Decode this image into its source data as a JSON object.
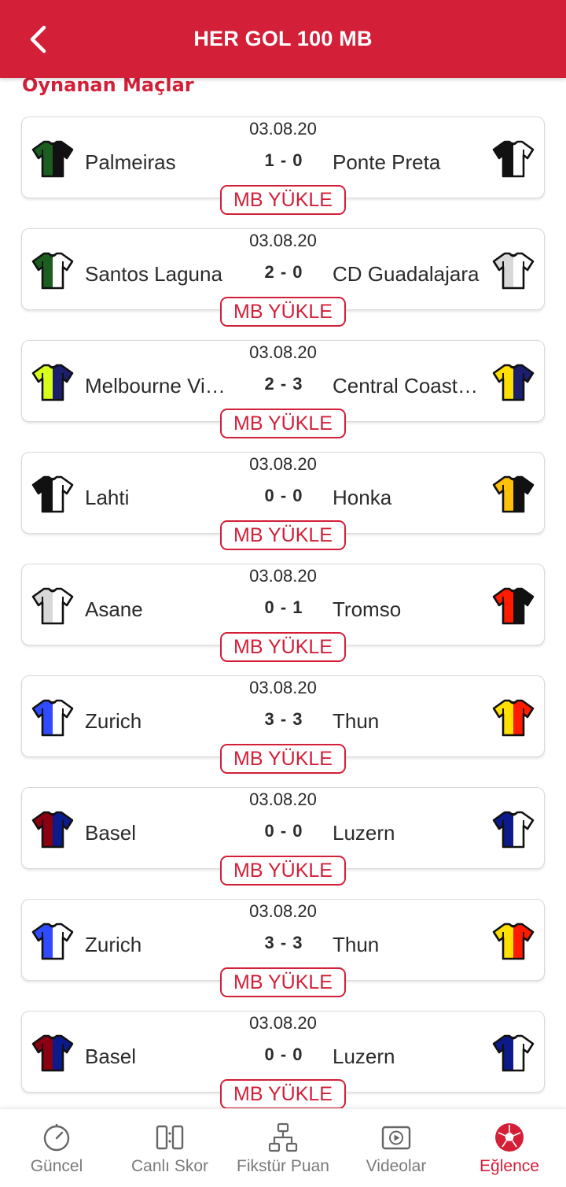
{
  "header": {
    "title": "HER GOL 100 MB",
    "back_icon": "chevron-left-icon"
  },
  "section_title": "Oynanan Maçlar",
  "colors": {
    "brand": "#d31f37",
    "text": "#2b2b2b",
    "inactive": "#7a7a7a"
  },
  "matches": [
    {
      "date": "03.08.20",
      "home": "Palmeiras",
      "score": "1 - 0",
      "away": "Ponte Preta",
      "button": "MB YÜKLE",
      "home_kit": [
        "#1b5e20",
        "#111111"
      ],
      "away_kit": [
        "#111111",
        "#ffffff"
      ]
    },
    {
      "date": "03.08.20",
      "home": "Santos Laguna",
      "score": "2 - 0",
      "away": "CD Guadalajara",
      "button": "MB YÜKLE",
      "home_kit": [
        "#1b5e20",
        "#ffffff"
      ],
      "away_kit": [
        "#d8d8d8",
        "#ffffff"
      ]
    },
    {
      "date": "03.08.20",
      "home": "Melbourne Vi…",
      "score": "2 - 3",
      "away": "Central Coast…",
      "button": "MB YÜKLE",
      "home_kit": [
        "#d7ff1a",
        "#1b1f6e"
      ],
      "away_kit": [
        "#ffe000",
        "#1b1f6e"
      ]
    },
    {
      "date": "03.08.20",
      "home": "Lahti",
      "score": "0 - 0",
      "away": "Honka",
      "button": "MB YÜKLE",
      "home_kit": [
        "#111111",
        "#ffffff"
      ],
      "away_kit": [
        "#ffc107",
        "#111111"
      ]
    },
    {
      "date": "03.08.20",
      "home": "Asane",
      "score": "0 - 1",
      "away": "Tromso",
      "button": "MB YÜKLE",
      "home_kit": [
        "#d8d8d8",
        "#ffffff"
      ],
      "away_kit": [
        "#ff1a00",
        "#111111"
      ]
    },
    {
      "date": "03.08.20",
      "home": "Zurich",
      "score": "3 - 3",
      "away": "Thun",
      "button": "MB YÜKLE",
      "home_kit": [
        "#2f4bff",
        "#ffffff"
      ],
      "away_kit": [
        "#ffe000",
        "#ff1a00"
      ]
    },
    {
      "date": "03.08.20",
      "home": "Basel",
      "score": "0 - 0",
      "away": "Luzern",
      "button": "MB YÜKLE",
      "home_kit": [
        "#8b0010",
        "#0d1a8c"
      ],
      "away_kit": [
        "#0d1a8c",
        "#ffffff"
      ]
    },
    {
      "date": "03.08.20",
      "home": "Zurich",
      "score": "3 - 3",
      "away": "Thun",
      "button": "MB YÜKLE",
      "home_kit": [
        "#2f4bff",
        "#ffffff"
      ],
      "away_kit": [
        "#ffe000",
        "#ff1a00"
      ]
    },
    {
      "date": "03.08.20",
      "home": "Basel",
      "score": "0 - 0",
      "away": "Luzern",
      "button": "MB YÜKLE",
      "home_kit": [
        "#8b0010",
        "#0d1a8c"
      ],
      "away_kit": [
        "#0d1a8c",
        "#ffffff"
      ]
    }
  ],
  "bottom_nav": [
    {
      "label": "Güncel",
      "icon": "stopwatch-icon",
      "active": false
    },
    {
      "label": "Canlı Skor",
      "icon": "scoreboard-icon",
      "active": false
    },
    {
      "label": "Fikstür Puan",
      "icon": "fixture-tree-icon",
      "active": false
    },
    {
      "label": "Videolar",
      "icon": "play-video-icon",
      "active": false
    },
    {
      "label": "Eğlence",
      "icon": "football-icon",
      "active": true
    }
  ]
}
